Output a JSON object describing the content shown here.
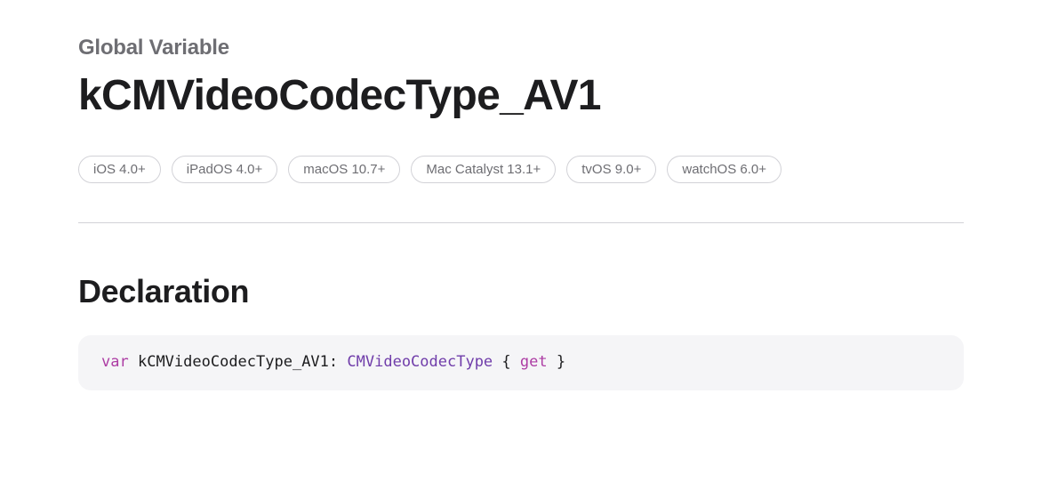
{
  "eyebrow": "Global Variable",
  "title": "kCMVideoCodecType_AV1",
  "platforms": [
    "iOS 4.0+",
    "iPadOS 4.0+",
    "macOS 10.7+",
    "Mac Catalyst 13.1+",
    "tvOS 9.0+",
    "watchOS 6.0+"
  ],
  "section_title": "Declaration",
  "declaration": {
    "var_keyword": "var",
    "identifier": "kCMVideoCodecType_AV1",
    "colon": ":",
    "type": "CMVideoCodecType",
    "brace_open": "{",
    "get_keyword": "get",
    "brace_close": "}"
  }
}
